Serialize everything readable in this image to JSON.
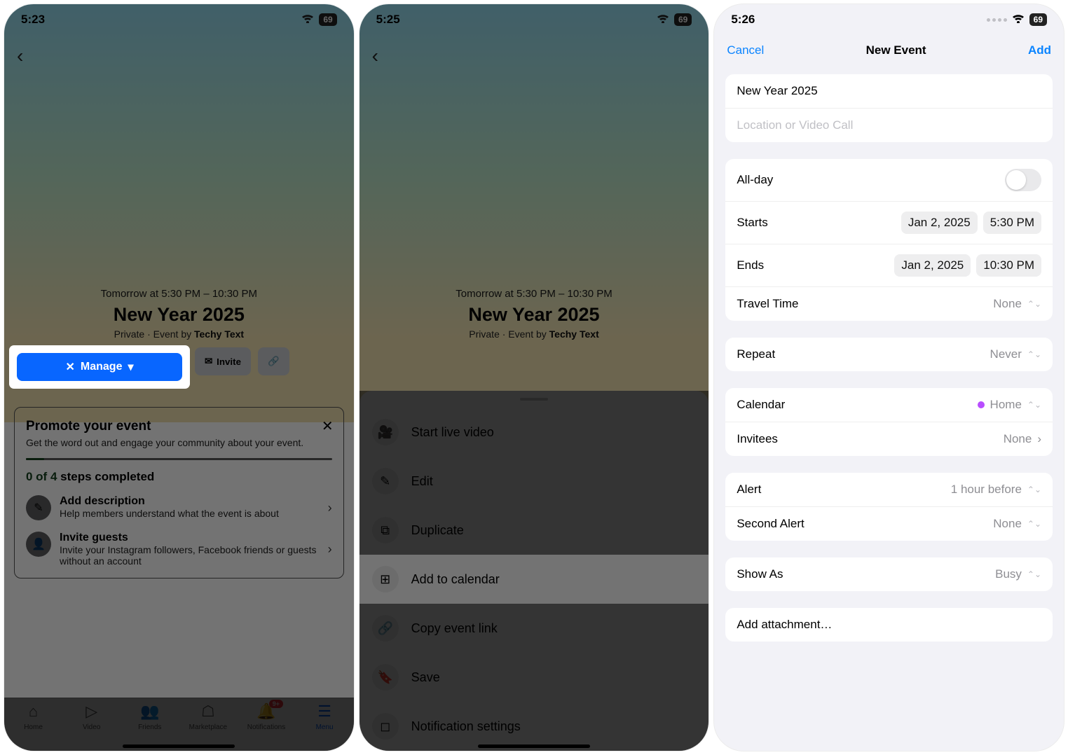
{
  "phone1": {
    "status_time": "5:23",
    "battery": "69",
    "event": {
      "time": "Tomorrow at 5:30 PM – 10:30 PM",
      "title": "New Year 2025",
      "privacy_prefix": "Private · Event by ",
      "creator": "Techy Text"
    },
    "buttons": {
      "manage": "Manage",
      "invite": "Invite"
    },
    "promote": {
      "title": "Promote your event",
      "sub": "Get the word out and engage your community about your event.",
      "steps_count": "0 of 4",
      "steps_suffix": " steps completed",
      "item1_title": "Add description",
      "item1_sub": "Help members understand what the event is about",
      "item2_title": "Invite guests",
      "item2_sub": "Invite your Instagram followers, Facebook friends or guests without an account"
    },
    "tabs": {
      "home": "Home",
      "video": "Video",
      "friends": "Friends",
      "marketplace": "Marketplace",
      "notifications": "Notifications",
      "menu": "Menu",
      "badge": "9+"
    }
  },
  "phone2": {
    "status_time": "5:25",
    "event": {
      "time": "Tomorrow at 5:30 PM – 10:30 PM",
      "title": "New Year 2025",
      "privacy_prefix": "Private · Event by ",
      "creator": "Techy Text"
    },
    "sheet": {
      "live": "Start live video",
      "edit": "Edit",
      "duplicate": "Duplicate",
      "add_calendar": "Add to calendar",
      "copy_link": "Copy event link",
      "save": "Save",
      "notification": "Notification settings"
    }
  },
  "phone3": {
    "status_time": "5:26",
    "battery": "69",
    "nav": {
      "cancel": "Cancel",
      "title": "New Event",
      "add": "Add"
    },
    "title_value": "New Year 2025",
    "location_placeholder": "Location or Video Call",
    "allday_label": "All-day",
    "starts_label": "Starts",
    "starts_date": "Jan 2, 2025",
    "starts_time": "5:30 PM",
    "ends_label": "Ends",
    "ends_date": "Jan 2, 2025",
    "ends_time": "10:30 PM",
    "travel_label": "Travel Time",
    "travel_value": "None",
    "repeat_label": "Repeat",
    "repeat_value": "Never",
    "calendar_label": "Calendar",
    "calendar_value": "Home",
    "invitees_label": "Invitees",
    "invitees_value": "None",
    "alert_label": "Alert",
    "alert_value": "1 hour before",
    "second_alert_label": "Second Alert",
    "second_alert_value": "None",
    "showas_label": "Show As",
    "showas_value": "Busy",
    "attachment_label": "Add attachment…"
  }
}
